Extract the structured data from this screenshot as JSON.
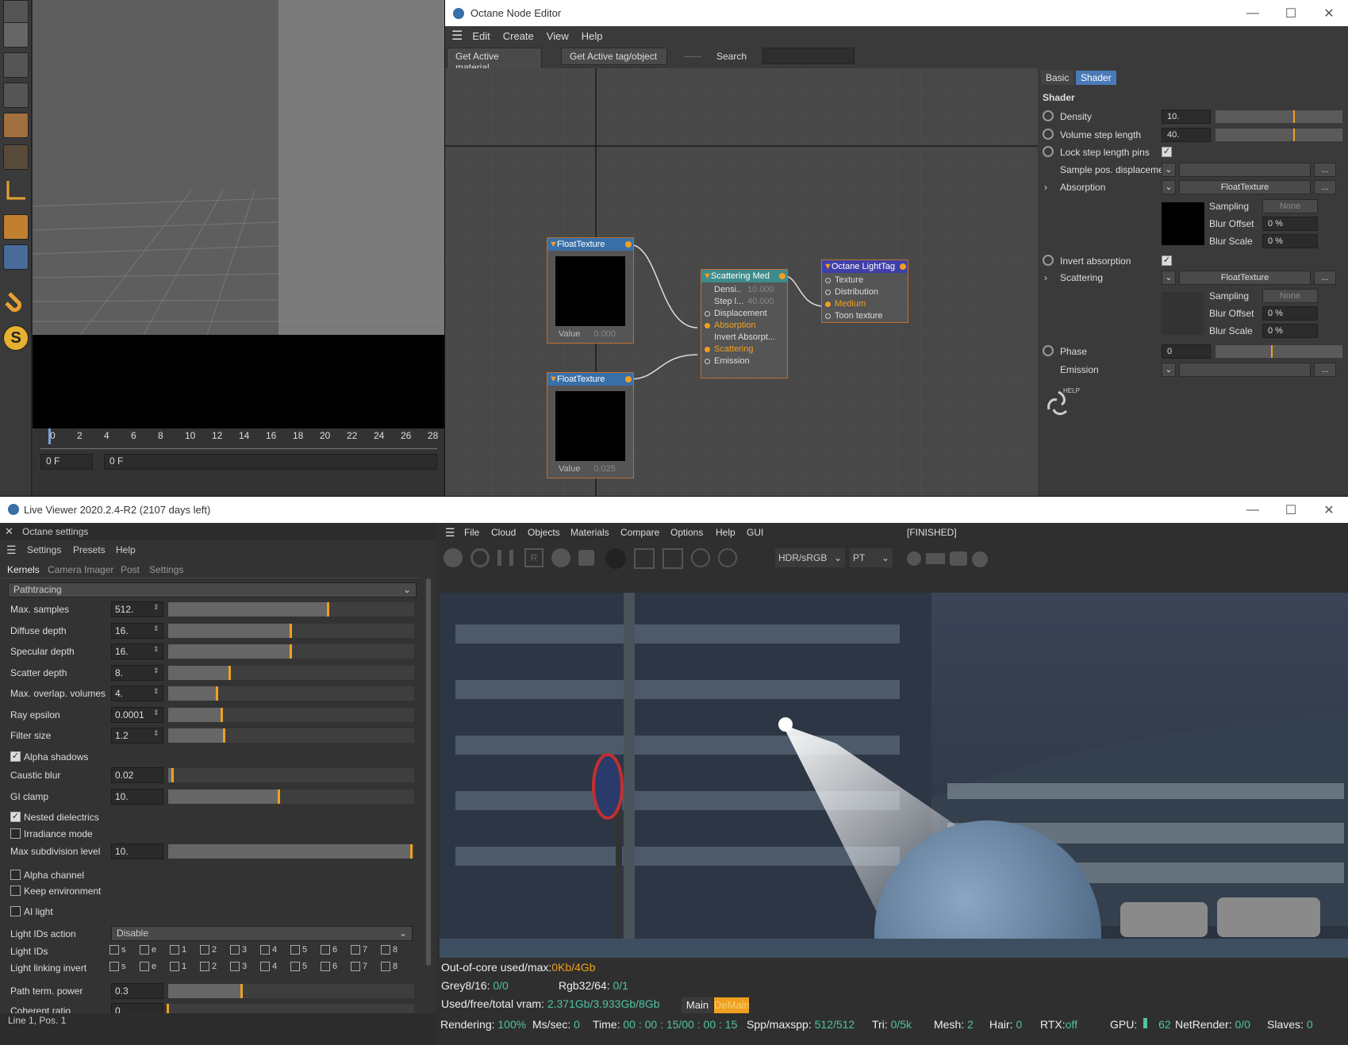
{
  "timeline": {
    "ticks": [
      "0",
      "2",
      "4",
      "6",
      "8",
      "10",
      "12",
      "14",
      "16",
      "18",
      "20",
      "22",
      "24",
      "26",
      "28"
    ],
    "frame_field": "0 F",
    "frame_field2": "0 F"
  },
  "node_editor": {
    "title": "Octane Node Editor",
    "menu": [
      "Edit",
      "Create",
      "View",
      "Help"
    ],
    "buttons": {
      "active_material": "Get Active material",
      "active_tag": "Get Active tag/object"
    },
    "search_label": "Search",
    "nodes": {
      "float1": {
        "title": "FloatTexture",
        "value_label": "Value",
        "value": "0.000"
      },
      "float2": {
        "title": "FloatTexture",
        "value_label": "Value",
        "value": "0.025"
      },
      "scatter": {
        "title": "Scattering Med",
        "rows": [
          "Densi..",
          "Step l...",
          "Displacement",
          "Absorption",
          "Invert Absorpt...",
          "Scattering",
          "Emission"
        ],
        "densi_val": "10.000",
        "step_val": "40.000"
      },
      "lighttag": {
        "title": "Octane LightTag",
        "rows": [
          "Texture",
          "Distribution",
          "Medium",
          "Toon texture"
        ]
      }
    },
    "props": {
      "tabs": [
        "Basic",
        "Shader"
      ],
      "section": "Shader",
      "density_label": "Density",
      "density_value": "10.",
      "volstep_label": "Volume step length",
      "volstep_value": "40.",
      "lockstep_label": "Lock step length pins",
      "samplepos_label": "Sample pos. displacement",
      "absorption_label": "Absorption",
      "absorption_value": "FloatTexture",
      "sampling_label": "Sampling",
      "sampling_value": "None",
      "bluroffset_label": "Blur Offset",
      "bluroffset_value": "0 %",
      "blurscale_label": "Blur Scale",
      "blurscale_value": "0 %",
      "invertabs_label": "Invert absorption",
      "scattering_label": "Scattering",
      "scattering_value": "FloatTexture",
      "phase_label": "Phase",
      "phase_value": "0",
      "emission_label": "Emission",
      "more": "...",
      "help": "HELP"
    }
  },
  "live_viewer": {
    "title": "Live Viewer 2020.2.4-R2 (2107 days left)",
    "settings_title": "Octane settings",
    "settings_menu": [
      "Settings",
      "Presets",
      "Help"
    ],
    "tabs": [
      "Kernels",
      "Camera Imager",
      "Post",
      "Settings"
    ],
    "kernel": "Pathtracing",
    "rows": [
      {
        "label": "Max. samples",
        "value": "512.",
        "fill": 0.65
      },
      {
        "label": "Diffuse depth",
        "value": "16.",
        "fill": 0.5
      },
      {
        "label": "Specular depth",
        "value": "16.",
        "fill": 0.5
      },
      {
        "label": "Scatter depth",
        "value": "8.",
        "fill": 0.25
      },
      {
        "label": "Max. overlap. volumes",
        "value": "4.",
        "fill": 0.2
      },
      {
        "label": "Ray epsilon",
        "value": "0.0001",
        "fill": 0.22
      },
      {
        "label": "Filter size",
        "value": "1.2",
        "fill": 0.23
      }
    ],
    "alpha_shadows": "Alpha shadows",
    "caustic_blur": {
      "label": "Caustic blur",
      "value": "0.02",
      "fill": 0.02
    },
    "gi_clamp": {
      "label": "GI clamp",
      "value": "10.",
      "fill": 0.45
    },
    "nested_dielectrics": "Nested dielectrics",
    "irradiance_mode": "Irradiance mode",
    "max_subdiv": {
      "label": "Max subdivision level",
      "value": "10.",
      "fill": 0.99
    },
    "alpha_channel": "Alpha channel",
    "keep_env": "Keep environment",
    "ai_light": "AI light",
    "light_ids_action": {
      "label": "Light IDs action",
      "value": "Disable"
    },
    "light_ids_label": "Light IDs",
    "light_link_label": "Light linking invert",
    "id_boxes": [
      "s",
      "e",
      "1",
      "2",
      "3",
      "4",
      "5",
      "6",
      "7",
      "8"
    ],
    "path_term": {
      "label": "Path term. power",
      "value": "0.3",
      "fill": 0.3
    },
    "coherent": {
      "label": "Coherent ratio",
      "value": "0",
      "fill": 0.0
    },
    "status_line": "Line 1, Pos. 1",
    "render_menu": [
      "File",
      "Cloud",
      "Objects",
      "Materials",
      "Compare",
      "Options",
      "Help",
      "GUI"
    ],
    "finished": "[FINISHED]",
    "colorspace": "HDR/sRGB",
    "mode": "PT",
    "stats": {
      "ooc_label": "Out-of-core used/max:",
      "ooc_val": "0Kb/4Gb",
      "grey_label": "Grey8/16:",
      "grey_val": "0/0",
      "rgb_label": "Rgb32/64:",
      "rgb_val": "0/1",
      "vram_label": "Used/free/total vram:",
      "vram_val": "2.371Gb/3.933Gb/8Gb",
      "main_tab": "Main",
      "demain_tab": "DeMain"
    },
    "bottom": {
      "rendering_label": "Rendering:",
      "rendering_val": "100%",
      "ms_label": "Ms/sec:",
      "ms_val": "0",
      "time_label": "Time:",
      "time_val": "00 : 00 : 15/00 : 00 : 15",
      "spp_label": "Spp/maxspp:",
      "spp_val": "512/512",
      "tri_label": "Tri:",
      "tri_val": "0/5k",
      "mesh_label": "Mesh:",
      "mesh_val": "2",
      "hair_label": "Hair:",
      "hair_val": "0",
      "rtx_label": "RTX:",
      "rtx_val": "off",
      "gpu_label": "GPU:",
      "gpu_val": "62",
      "net_label": "NetRender:",
      "net_val": "0/0",
      "slaves_label": "Slaves:",
      "slaves_val": "0"
    }
  },
  "colors": {
    "accent": "#f0a020",
    "node_header": "#3a6fa8",
    "tab_active": "#4a7ab8",
    "stat_green": "#4fc3a1"
  }
}
